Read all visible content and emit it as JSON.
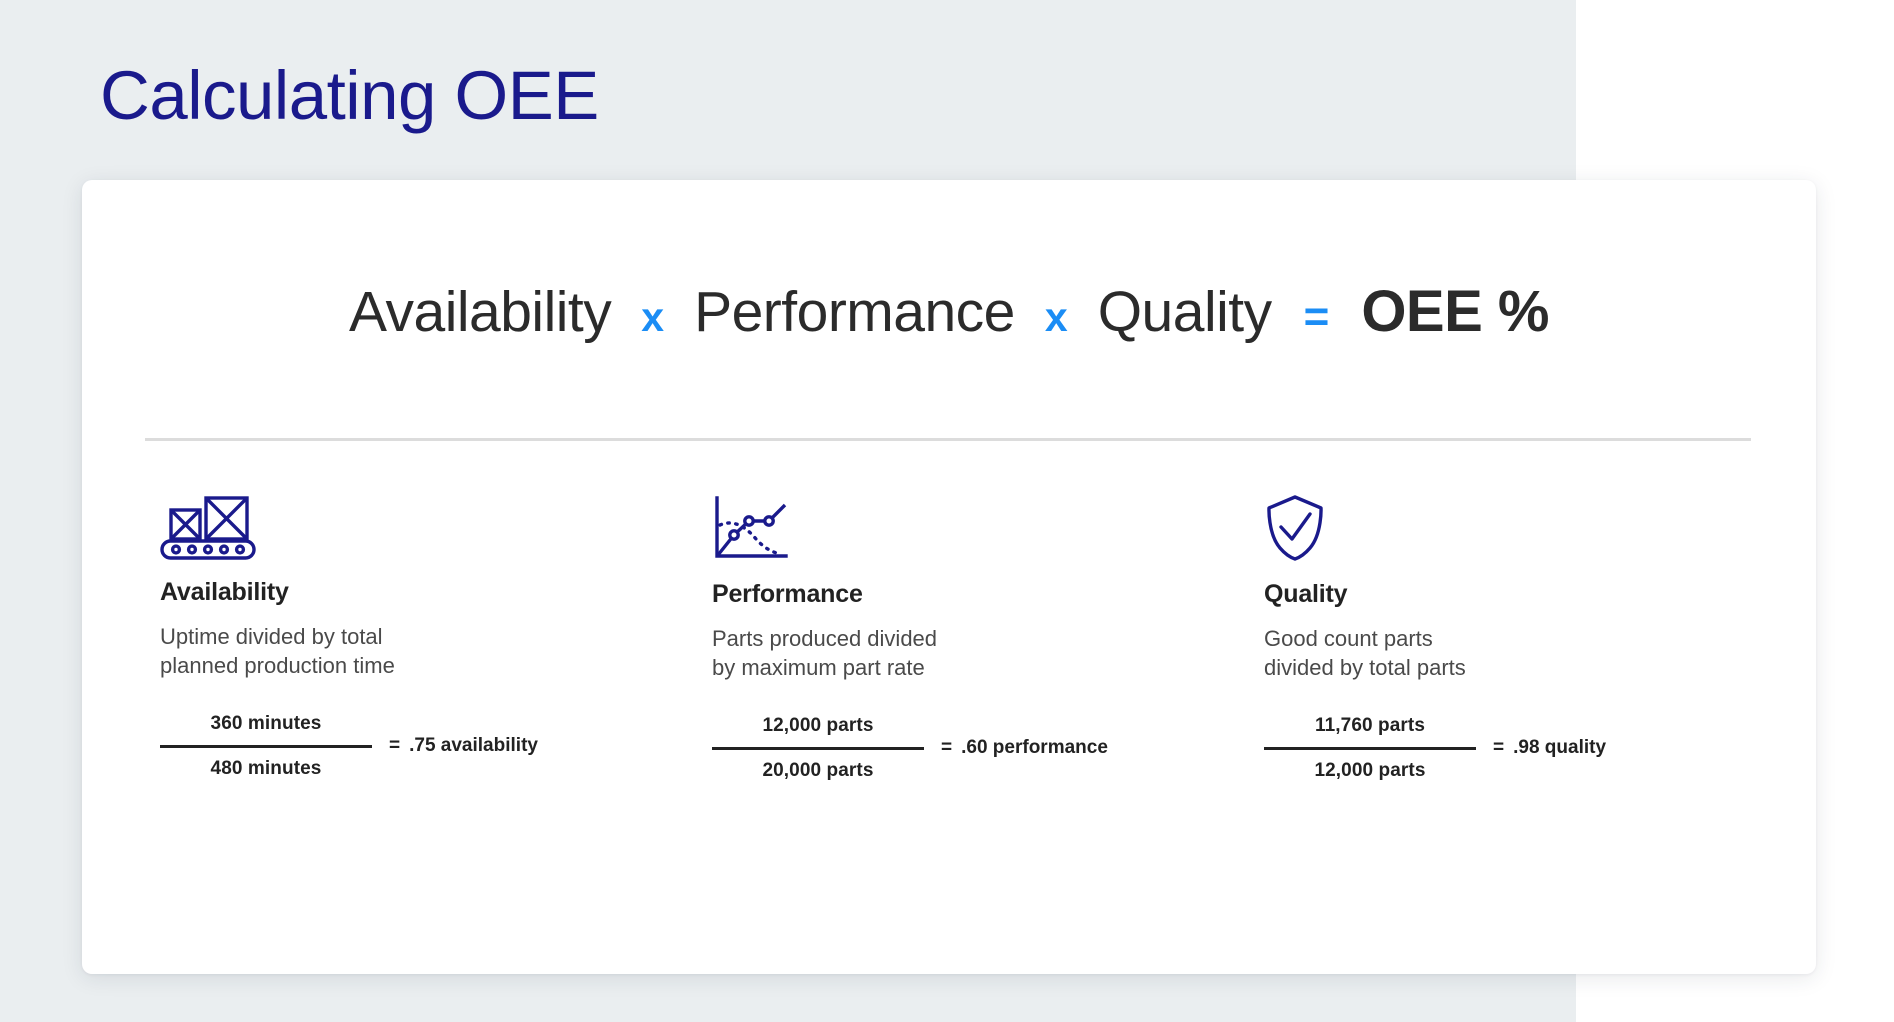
{
  "page": {
    "title": "Calculating OEE",
    "title_color": "#1a1a8c",
    "background_color": "#eaeef0",
    "card_color": "#ffffff",
    "accent_color": "#1b8df5",
    "icon_color": "#1a1a8c"
  },
  "formula": {
    "term1": "Availability",
    "operator1": "x",
    "term2": "Performance",
    "operator2": "x",
    "term3": "Quality",
    "equals": "=",
    "result": "OEE %"
  },
  "metrics": [
    {
      "icon": "conveyor-belt-icon",
      "title": "Availability",
      "description": "Uptime divided by total\nplanned production time",
      "numerator": "360 minutes",
      "denominator": "480 minutes",
      "equals": "=",
      "result": ".75 availability"
    },
    {
      "icon": "performance-line-chart-icon",
      "title": "Performance",
      "description": "Parts produced divided\nby maximum part rate",
      "numerator": "12,000 parts",
      "denominator": "20,000 parts",
      "equals": "=",
      "result": ".60 performance"
    },
    {
      "icon": "shield-check-icon",
      "title": "Quality",
      "description": "Good count parts\ndivided by total parts",
      "numerator": "11,760 parts",
      "denominator": "12,000 parts",
      "equals": "=",
      "result": ".98 quality"
    }
  ]
}
